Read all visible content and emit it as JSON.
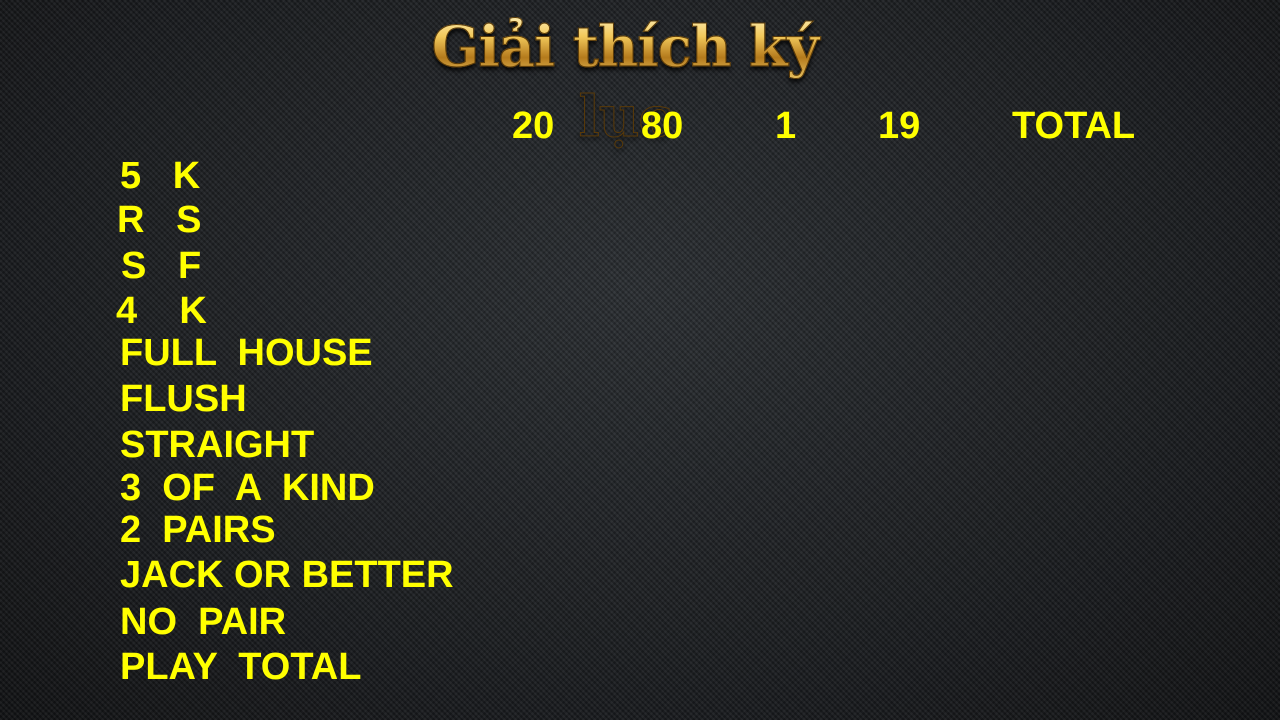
{
  "title": "Giải thích ký lục",
  "columns": [
    "20",
    "80",
    "1",
    "19",
    "TOTAL"
  ],
  "rows": [
    "5   K",
    "R   S",
    "S   F",
    "4    K",
    "FULL  HOUSE",
    "FLUSH",
    "STRAIGHT",
    "3  OF  A  KIND",
    "2  PAIRS",
    "JACK OR BETTER",
    "NO  PAIR",
    "PLAY  TOTAL"
  ],
  "colors": {
    "label": "#ffff00",
    "title_gold": "#e8b64a"
  }
}
